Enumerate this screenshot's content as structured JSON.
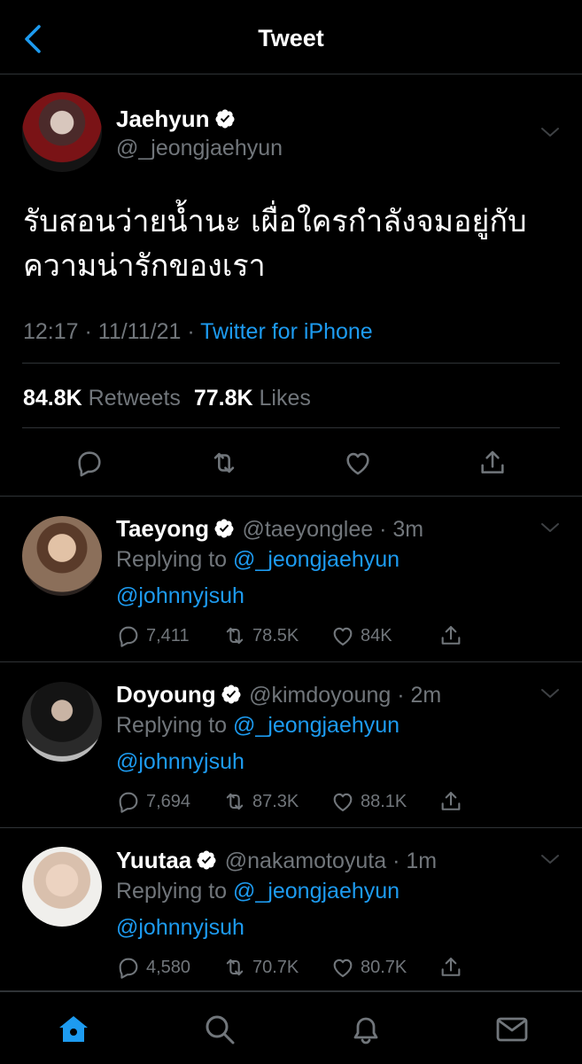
{
  "header": {
    "title": "Tweet"
  },
  "main_tweet": {
    "name": "Jaehyun",
    "handle": "@_jeongjaehyun",
    "text_line1": "รับสอนว่ายน้ำนะ เผื่อใครกำลังจมอยู่กับ",
    "text_line2": "ความน่ารักของเรา",
    "time": "12:17 · 11/11/21 · ",
    "source": "Twitter for iPhone",
    "retweets": "84.8K",
    "retweets_label": "Retweets",
    "likes": "77.8K",
    "likes_label": "Likes"
  },
  "replies": [
    {
      "name": "Taeyong",
      "handle": "@taeyonglee",
      "time": "3m",
      "replying_label": "Replying to",
      "replying_to": "@_jeongjaehyun",
      "mention": "@johnnyjsuh",
      "replies": "7,411",
      "retweets": "78.5K",
      "likes": "84K"
    },
    {
      "name": "Doyoung",
      "handle": "@kimdoyoung",
      "time": "2m",
      "replying_label": "Replying to",
      "replying_to": "@_jeongjaehyun",
      "mention": "@johnnyjsuh",
      "replies": "7,694",
      "retweets": "87.3K",
      "likes": "88.1K"
    },
    {
      "name": "Yuutaa",
      "handle": "@nakamotoyuta",
      "time": "1m",
      "replying_label": "Replying to",
      "replying_to": "@_jeongjaehyun",
      "mention": "@johnnyjsuh",
      "replies": "4,580",
      "retweets": "70.7K",
      "likes": "80.7K"
    }
  ],
  "icons": {
    "back": "chevron-left-icon",
    "verified": "verified-badge-icon",
    "more": "chevron-down-icon",
    "reply": "reply-icon",
    "retweet": "retweet-icon",
    "like": "heart-icon",
    "share": "share-icon",
    "tabs": [
      "home-icon",
      "search-icon",
      "notifications-icon",
      "messages-icon"
    ]
  },
  "colors": {
    "accent": "#1d9bf0",
    "background": "#000000",
    "muted": "#71767b"
  }
}
